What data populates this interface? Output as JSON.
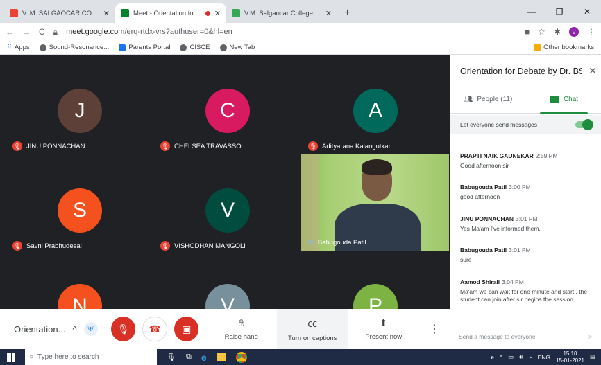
{
  "browser": {
    "tabs": [
      {
        "title": "V. M. SALGAOCAR COLLEGE OF L",
        "fav_color": "#ea4335"
      },
      {
        "title": "Meet - Orientation for Deba",
        "fav_color": "#00832d"
      },
      {
        "title": "V.M. Salgaocar College of Law –",
        "fav_color": "#34a853"
      }
    ],
    "new_tab": "+",
    "url_host": "meet.google.com",
    "url_path": "/erq-rtdx-vrs?authuser=0&hl=en",
    "profile_initial": "V",
    "bookmarks": [
      "Apps",
      "Sound-Resonance...",
      "Parents Portal",
      "CISCE",
      "New Tab"
    ],
    "other_bookmarks": "Other bookmarks"
  },
  "participants": [
    {
      "initial": "J",
      "name": "JINU PONNACHAN",
      "color": "#5d4037"
    },
    {
      "initial": "C",
      "name": "CHELSEA TRAVASSO",
      "color": "#d81b60"
    },
    {
      "initial": "A",
      "name": "Adityarana Kalangutkar",
      "color": "#00695c"
    },
    {
      "initial": "S",
      "name": "Savni Prabhudesai",
      "color": "#f4511e"
    },
    {
      "initial": "V",
      "name": "VISHODHAN MANGOLI",
      "color": "#004d40"
    },
    {
      "initial": "N",
      "name": "",
      "color": "#f4511e"
    },
    {
      "initial": "V",
      "name": "",
      "color": "#78909c"
    },
    {
      "initial": "P",
      "name": "",
      "color": "#7cb342"
    }
  ],
  "video_participant": {
    "name": "Babugouda Patil"
  },
  "bottom_bar": {
    "meeting_name": "Orientation...",
    "raise_hand": "Raise hand",
    "captions": "Turn on captions",
    "present": "Present now"
  },
  "panel": {
    "title": "Orientation for Debate by Dr. BS ...",
    "people_tab": "People (11)",
    "chat_tab": "Chat",
    "permission_label": "Let everyone send messages",
    "messages": [
      {
        "sender": "PRAPTI NAIK GAUNEKAR",
        "time": "2:59 PM",
        "text": "Good afternoon sir"
      },
      {
        "sender": "Babugouda Patil",
        "time": "3:00 PM",
        "text": "good afternoon"
      },
      {
        "sender": "JINU PONNACHAN",
        "time": "3:01 PM",
        "text": "Yes Ma'am I've informed them."
      },
      {
        "sender": "Babugouda Patil",
        "time": "3:01 PM",
        "text": "sure"
      },
      {
        "sender": "Aamod Shirali",
        "time": "3:04 PM",
        "text": "Ma'am we can wait for one minute and start.. the student can join after sir begins the session"
      }
    ],
    "compose_placeholder": "Send a message to everyone"
  },
  "taskbar": {
    "search_placeholder": "Type here to search",
    "lang": "ENG",
    "time": "15:10",
    "date": "15-01-2021"
  }
}
